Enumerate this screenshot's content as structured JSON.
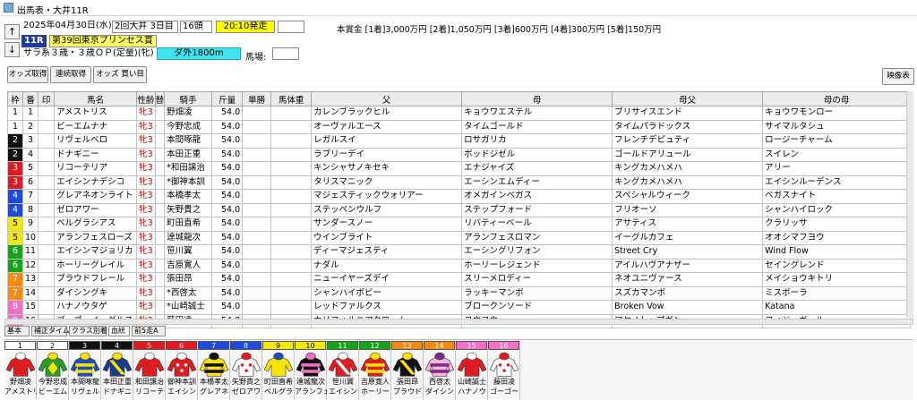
{
  "window": {
    "title": "出馬表・大井11R"
  },
  "race": {
    "date": "2025年04月30日(水)",
    "meeting": "2回大井 3日目",
    "runners": "16頭",
    "post_time": "20:10発走",
    "extra": "",
    "number": "11R",
    "name": "第39回東京プリンセス賞",
    "conditions": "サラ系３歳・３歳ＯＰ(定量)(牝)",
    "course": "ダ外1800m",
    "going_label": "馬場:",
    "going_value": "",
    "prize_label": "本賞金 [1着]3,000万円 [2着]1,050万円 [3着]600万円 [4着]300万円 [5着]150万円"
  },
  "toolbar": {
    "odds": "オッズ取得",
    "results": "連続取得",
    "buy": "オッズ 買い目",
    "video": "映像表"
  },
  "columns": [
    "枠",
    "番",
    "印",
    "馬名",
    "性齢",
    "替",
    "騎手",
    "斤量",
    "単勝",
    "馬体重",
    "父",
    "母",
    "母父",
    "母の母"
  ],
  "colors": {
    "waku": [
      "#ffffff",
      "#111111",
      "#e11b22",
      "#1f49d8",
      "#f3e80b",
      "#16a319",
      "#f58a12",
      "#f26fc6"
    ],
    "post_time_bg": "#ffff00",
    "race_name_bg": "#ffff66",
    "course_bg": "#42e3f0",
    "sex_color": "#c00000"
  },
  "entries": [
    {
      "waku": 1,
      "num": "1",
      "mark": "",
      "name": "アメストリス",
      "sexage": "牝3",
      "chg": "",
      "jockey": "野畑凌",
      "weight": "54.0",
      "odds": "",
      "bw": "",
      "sire": "カレンブラックヒル",
      "dam": "キョウワエステル",
      "damsire": "ブリサイスエンド",
      "dam2": "キョウワモンロー"
    },
    {
      "waku": 1,
      "num": "2",
      "mark": "",
      "name": "ビーエムナナ",
      "sexage": "牝3",
      "chg": "",
      "jockey": "今野忠成",
      "weight": "54.0",
      "odds": "",
      "bw": "",
      "sire": "オーヴァルエース",
      "dam": "タイムゴールド",
      "damsire": "タイムパラドックス",
      "dam2": "サイマルタシュ"
    },
    {
      "waku": 2,
      "num": "3",
      "mark": "",
      "name": "リヴェルベロ",
      "sexage": "牝3",
      "chg": "",
      "jockey": "本間啄龍",
      "weight": "54.0",
      "odds": "",
      "bw": "",
      "sire": "レガルスイ",
      "dam": "ロサガリカ",
      "damsire": "フレンチデピュティ",
      "dam2": "ロージーチャーム"
    },
    {
      "waku": 2,
      "num": "4",
      "mark": "",
      "name": "ドナギニー",
      "sexage": "牝3",
      "chg": "",
      "jockey": "本田正重",
      "weight": "54.0",
      "odds": "",
      "bw": "",
      "sire": "ラブリーデイ",
      "dam": "ボッドジゼル",
      "damsire": "ゴールドアリュール",
      "dam2": "スイレン"
    },
    {
      "waku": 3,
      "num": "5",
      "mark": "",
      "name": "リコーテリア",
      "sexage": "牝3",
      "chg": "",
      "jockey": "*和田譲治",
      "weight": "54.0",
      "odds": "",
      "bw": "",
      "sire": "キンシャサノキセキ",
      "dam": "エナジャイズ",
      "damsire": "キングカメハメハ",
      "dam2": "アリー"
    },
    {
      "waku": 3,
      "num": "6",
      "mark": "",
      "name": "エイシンナデシコ",
      "sexage": "牝3",
      "chg": "",
      "jockey": "*御神本訓",
      "weight": "54.0",
      "odds": "",
      "bw": "",
      "sire": "タリスマニック",
      "dam": "エーシンエムディー",
      "damsire": "キングカメハメハ",
      "dam2": "エイシンルーデンス"
    },
    {
      "waku": 4,
      "num": "7",
      "mark": "",
      "name": "グレアネオンライト",
      "sexage": "牝3",
      "chg": "",
      "jockey": "本橋孝太",
      "weight": "54.0",
      "odds": "",
      "bw": "",
      "sire": "マジェスティックウォリアー",
      "dam": "オメガインベガス",
      "damsire": "スペシャルウィーク",
      "dam2": "ベガスナイト"
    },
    {
      "waku": 4,
      "num": "8",
      "mark": "",
      "name": "ゼロアワー",
      "sexage": "牝3",
      "chg": "",
      "jockey": "矢野貴之",
      "weight": "54.0",
      "odds": "",
      "bw": "",
      "sire": "ステッペンウルフ",
      "dam": "ステップフォード",
      "damsire": "フリオーソ",
      "dam2": "シャンハイロック"
    },
    {
      "waku": 5,
      "num": "9",
      "mark": "",
      "name": "ベルグラシアス",
      "sexage": "牝3",
      "chg": "",
      "jockey": "町田直希",
      "weight": "54.0",
      "odds": "",
      "bw": "",
      "sire": "サンダースノー",
      "dam": "リバティーベール",
      "damsire": "アサティス",
      "dam2": "クラリッサ"
    },
    {
      "waku": 5,
      "num": "10",
      "mark": "",
      "name": "アランフェスローズ",
      "sexage": "牝3",
      "chg": "",
      "jockey": "達城龍次",
      "weight": "54.0",
      "odds": "",
      "bw": "",
      "sire": "ウインブライト",
      "dam": "アランフェスロマン",
      "damsire": "イーグルカフェ",
      "dam2": "オオシマフヨウ"
    },
    {
      "waku": 6,
      "num": "11",
      "mark": "",
      "name": "エイシンマジョリカ",
      "sexage": "牝3",
      "chg": "",
      "jockey": "笹川翼",
      "weight": "54.0",
      "odds": "",
      "bw": "",
      "sire": "ディーマジェスティ",
      "dam": "エーシングリフォン",
      "damsire": "Street Cry",
      "dam2": "Wind Flow"
    },
    {
      "waku": 6,
      "num": "12",
      "mark": "",
      "name": "ホーリーグレイル",
      "sexage": "牝3",
      "chg": "",
      "jockey": "吉原寛人",
      "weight": "54.0",
      "odds": "",
      "bw": "",
      "sire": "ナダル",
      "dam": "ホーリーレジェンド",
      "damsire": "アイルハヴアナザー",
      "dam2": "セイングレンド"
    },
    {
      "waku": 7,
      "num": "13",
      "mark": "",
      "name": "プラウドフレール",
      "sexage": "牝3",
      "chg": "",
      "jockey": "張田昂",
      "weight": "54.0",
      "odds": "",
      "bw": "",
      "sire": "ニューイヤーズデイ",
      "dam": "スリーメロディー",
      "damsire": "ネオユニヴァース",
      "dam2": "メイショウキトリ"
    },
    {
      "waku": 7,
      "num": "14",
      "mark": "",
      "name": "ダイシングキ",
      "sexage": "牝3",
      "chg": "",
      "jockey": "*西啓太",
      "weight": "54.0",
      "odds": "",
      "bw": "",
      "sire": "シャンハイボビー",
      "dam": "ラッキーマンボ",
      "damsire": "スズカマンボ",
      "dam2": "ミスボーラ"
    },
    {
      "waku": 8,
      "num": "15",
      "mark": "",
      "name": "ハナノウタゲ",
      "sexage": "牝3",
      "chg": "",
      "jockey": "*山崎誠士",
      "weight": "54.0",
      "odds": "",
      "bw": "",
      "sire": "レッドファルクス",
      "dam": "ブロークンソード",
      "damsire": "Broken Vow",
      "dam2": "Katana"
    },
    {
      "waku": 8,
      "num": "16",
      "mark": "",
      "name": "ゴーゴーイーグルス",
      "sexage": "牝3",
      "chg": "",
      "jockey": "藤田凌",
      "weight": "54.0",
      "odds": "",
      "bw": "",
      "sire": "カリフォルニアクローム",
      "dam": "ヨウヨウ",
      "damsire": "マヤノトップガン",
      "dam2": "フィジーガール"
    }
  ],
  "tabs": [
    "基本",
    "補正タイム",
    "クラス別着",
    "血統",
    "前5走A"
  ],
  "silks": [
    {
      "num": "1",
      "jockey": "野畑凌",
      "horse": "アメストリ",
      "colors": [
        "#e11b22",
        "#ffffff"
      ],
      "pattern": "plain"
    },
    {
      "num": "2",
      "jockey": "今野忠成",
      "horse": "ビーエム",
      "colors": [
        "#2a9d2a",
        "#ffe400"
      ],
      "pattern": "diamond"
    },
    {
      "num": "3",
      "jockey": "本間啄龍",
      "horse": "リヴェル",
      "colors": [
        "#1a4fc4",
        "#ffe400"
      ],
      "pattern": "hoops"
    },
    {
      "num": "4",
      "jockey": "本田正重",
      "horse": "ドナギニ",
      "colors": [
        "#1a3a8c",
        "#ffe400"
      ],
      "pattern": "sash"
    },
    {
      "num": "5",
      "jockey": "和田譲治",
      "horse": "リコーテ",
      "colors": [
        "#e11b22",
        "#ffffff"
      ],
      "pattern": "plain"
    },
    {
      "num": "6",
      "jockey": "御神本訓",
      "horse": "エイシン",
      "colors": [
        "#e11b22",
        "#ffffff"
      ],
      "pattern": "dots"
    },
    {
      "num": "7",
      "jockey": "本橋孝太",
      "horse": "グレアネ",
      "colors": [
        "#ffe400",
        "#111111"
      ],
      "pattern": "hoops"
    },
    {
      "num": "8",
      "jockey": "矢野貴之",
      "horse": "ゼロアワ",
      "colors": [
        "#ffffff",
        "#e11b22"
      ],
      "pattern": "dots"
    },
    {
      "num": "9",
      "jockey": "町田直希",
      "horse": "ベルグラ",
      "colors": [
        "#ffe400",
        "#1a4fc4"
      ],
      "pattern": "plain"
    },
    {
      "num": "10",
      "jockey": "達城龍次",
      "horse": "アランフェ",
      "colors": [
        "#111111",
        "#f26fc6"
      ],
      "pattern": "hoops"
    },
    {
      "num": "11",
      "jockey": "笹川翼",
      "horse": "エイシン",
      "colors": [
        "#e11b22",
        "#ffffff"
      ],
      "pattern": "sash"
    },
    {
      "num": "12",
      "jockey": "吉原寛人",
      "horse": "ホーリー",
      "colors": [
        "#e11b22",
        "#ffe400"
      ],
      "pattern": "hoops"
    },
    {
      "num": "13",
      "jockey": "張田昂",
      "horse": "プラウド",
      "colors": [
        "#111111",
        "#ffe400"
      ],
      "pattern": "sash"
    },
    {
      "num": "14",
      "jockey": "西啓太",
      "horse": "ダイシン",
      "colors": [
        "#f9b7d6",
        "#7a2b8c"
      ],
      "pattern": "hoops"
    },
    {
      "num": "15",
      "jockey": "山崎誠士",
      "horse": "ハナノウ",
      "colors": [
        "#e11b22",
        "#ffffff"
      ],
      "pattern": "plain"
    },
    {
      "num": "16",
      "jockey": "藤田凌",
      "horse": "ゴーゴー",
      "colors": [
        "#ffffff",
        "#e11b22"
      ],
      "pattern": "dots"
    }
  ]
}
